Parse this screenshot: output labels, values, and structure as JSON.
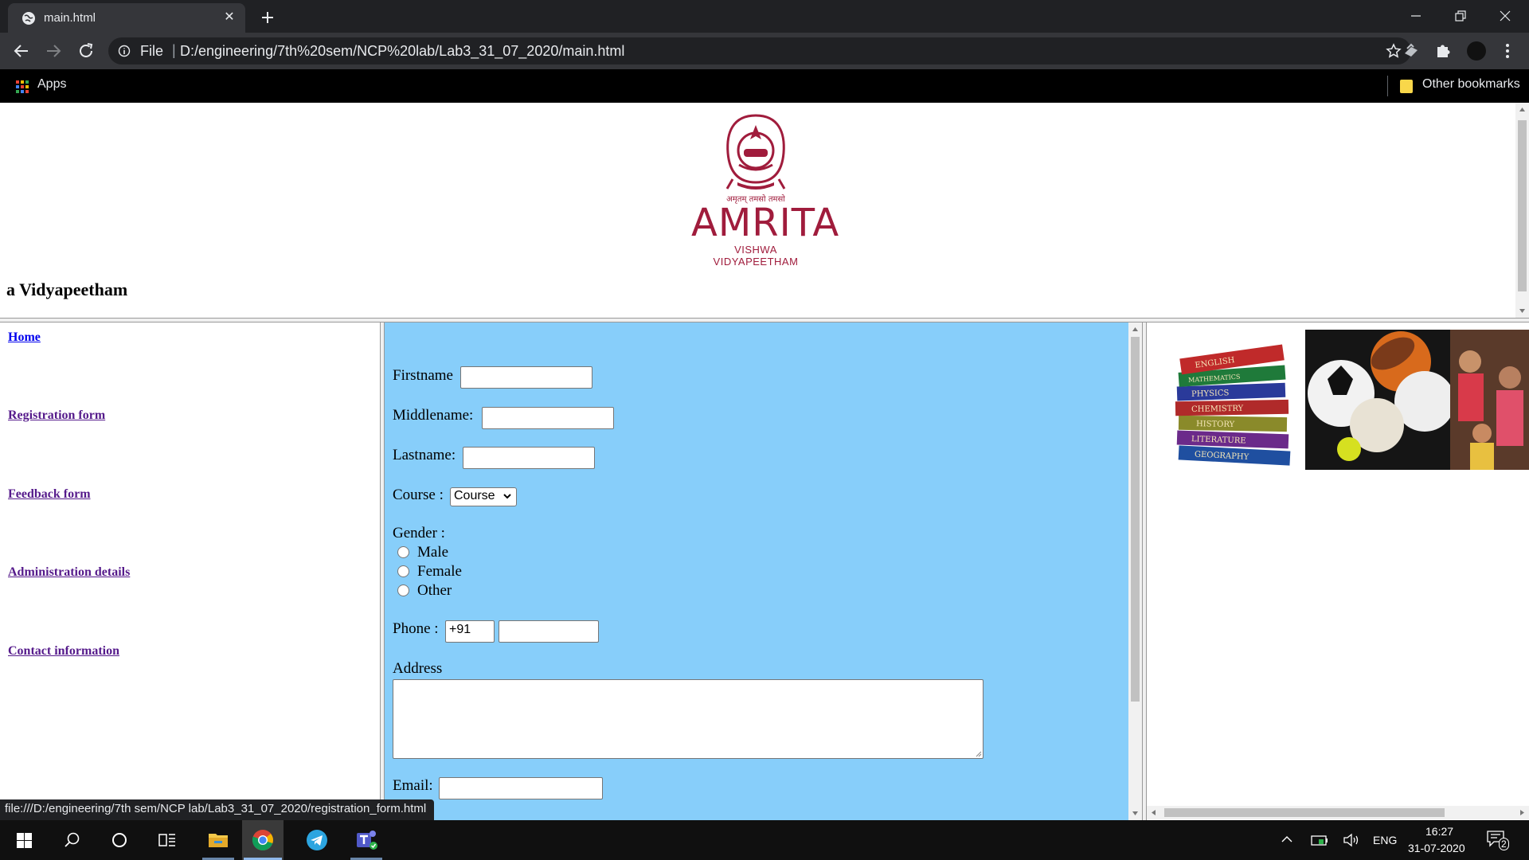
{
  "browser": {
    "tab_title": "main.html",
    "omnibox_scheme": "File",
    "omnibox_url": "D:/engineering/7th%20sem/NCP%20lab/Lab3_31_07_2020/main.html",
    "bookmarks": {
      "apps_label": "Apps",
      "other_label": "Other bookmarks"
    },
    "status_url": "file:///D:/engineering/7th sem/NCP lab/Lab3_31_07_2020/registration_form.html"
  },
  "banner": {
    "logo_script": "अमृतम् तमसो तमसो",
    "logo_name": "AMRITA",
    "logo_subtitle": "VISHWA VIDYAPEETHAM",
    "title": "a Vidyapeetham"
  },
  "nav": {
    "items": [
      {
        "label": "Home"
      },
      {
        "label": "Registration form"
      },
      {
        "label": "Feedback form"
      },
      {
        "label": "Administration details"
      },
      {
        "label": "Contact information"
      }
    ]
  },
  "form": {
    "firstname_label": "Firstname",
    "middlename_label": "Middlename:",
    "lastname_label": "Lastname:",
    "course_label": "Course :",
    "course_selected": "Course",
    "gender_label": "Gender :",
    "gender_options": [
      "Male",
      "Female",
      "Other"
    ],
    "phone_label": "Phone :",
    "phone_code": "+91",
    "address_label": "Address",
    "email_label": "Email:"
  },
  "images": {
    "books_labels": [
      "ENGLISH",
      "MATHEMATICS",
      "PHYSICS",
      "CHEMISTRY",
      "HISTORY",
      "LITERATURE",
      "GEOGRAPHY"
    ]
  },
  "taskbar": {
    "language": "ENG",
    "time": "16:27",
    "date": "31-07-2020",
    "notification_count": "2"
  },
  "colors": {
    "form_background": "#87cefa",
    "brand_maroon": "#a01c3c",
    "visited_link": "#551a8b"
  }
}
